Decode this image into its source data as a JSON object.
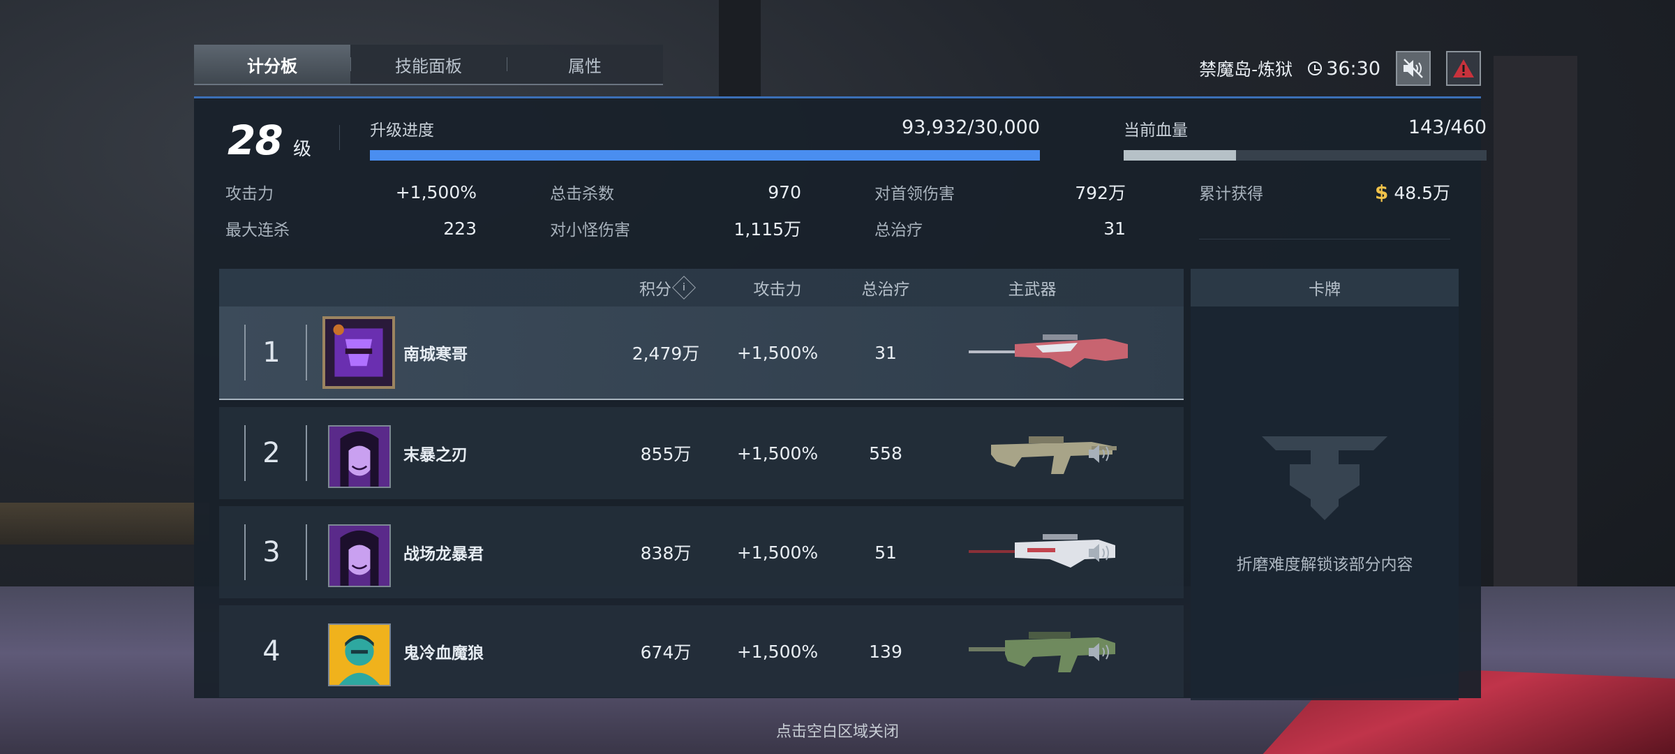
{
  "tabs": [
    {
      "label": "计分板",
      "active": true
    },
    {
      "label": "技能面板",
      "active": false
    },
    {
      "label": "属性",
      "active": false
    }
  ],
  "header": {
    "map_name": "禁魔岛-炼狱",
    "timer": "36:30",
    "mute_icon": "speaker-muted-icon",
    "report_icon": "warning-icon"
  },
  "player": {
    "level": "28",
    "level_unit": "级",
    "xp_label": "升级进度",
    "xp_value": "93,932/30,000",
    "xp_progress": 1.0,
    "hp_label": "当前血量",
    "hp_value": "143/460",
    "hp_progress": 0.31
  },
  "stats": [
    {
      "label": "攻击力",
      "value": "+1,500%"
    },
    {
      "label": "总击杀数",
      "value": "970"
    },
    {
      "label": "对首领伤害",
      "value": "792万"
    },
    {
      "label": "累计获得",
      "value": "48.5万"
    },
    {
      "label": "最大连杀",
      "value": "223"
    },
    {
      "label": "对小怪伤害",
      "value": "1,115万"
    },
    {
      "label": "总治疗",
      "value": "31"
    }
  ],
  "table": {
    "headers": {
      "score": "积分",
      "attack": "攻击力",
      "heal": "总治疗",
      "weapon": "主武器",
      "cards": "卡牌"
    },
    "rows": [
      {
        "rank": "1",
        "name": "南城寒哥",
        "score": "2,479万",
        "attack": "+1,500%",
        "heal": "31"
      },
      {
        "rank": "2",
        "name": "末暴之刃",
        "score": "855万",
        "attack": "+1,500%",
        "heal": "558"
      },
      {
        "rank": "3",
        "name": "战场龙暴君",
        "score": "838万",
        "attack": "+1,500%",
        "heal": "51"
      },
      {
        "rank": "4",
        "name": "鬼冷血魔狼",
        "score": "674万",
        "attack": "+1,500%",
        "heal": "139"
      }
    ]
  },
  "cards": {
    "locked_text": "折磨难度解锁该部分内容"
  },
  "close_hint": "点击空白区域关闭",
  "colors": {
    "accent": "#4a8ef0",
    "panel": "#18212b",
    "gold": "#f0c24a"
  }
}
